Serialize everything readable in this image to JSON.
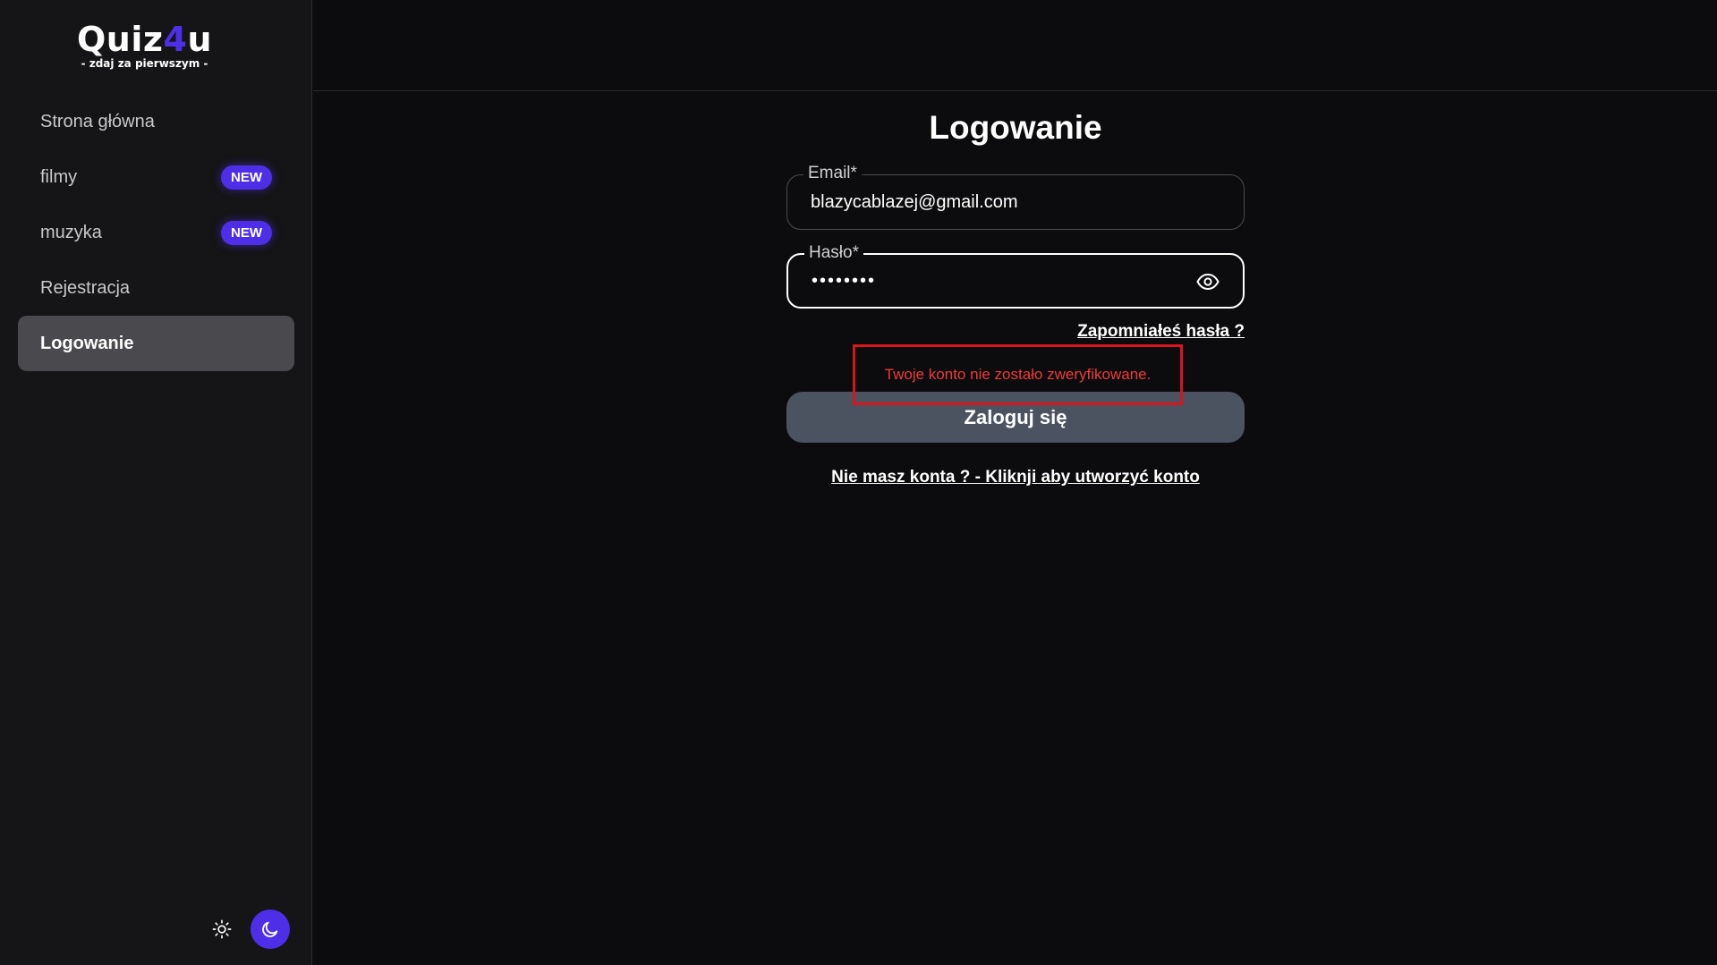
{
  "logo": {
    "title_prefix": "Quiz",
    "title_accent": "4",
    "title_suffix": "u",
    "subtitle": "- zdaj za pierwszym -"
  },
  "sidebar": {
    "items": [
      {
        "label": "Strona główna",
        "badge": ""
      },
      {
        "label": "filmy",
        "badge": "NEW"
      },
      {
        "label": "muzyka",
        "badge": "NEW"
      },
      {
        "label": "Rejestracja",
        "badge": ""
      },
      {
        "label": "Logowanie",
        "badge": "",
        "active": true
      }
    ]
  },
  "theme": {
    "light_icon": "sun-icon",
    "dark_icon": "moon-icon",
    "selected": "dark"
  },
  "form": {
    "title": "Logowanie",
    "email": {
      "label": "Email*",
      "value": "blazycablazej@gmail.com"
    },
    "password": {
      "label": "Hasło*",
      "value": "••••••••",
      "toggle_icon": "eye-icon"
    },
    "forgot_link": "Zapomniałeś hasła ?",
    "error_message": "Twoje konto nie zostało zweryfikowane.",
    "submit_label": "Zaloguj się",
    "register_link": "Nie masz konta ? - Kliknji aby utworzyć konto"
  },
  "colors": {
    "accent": "#4f2ee8",
    "error": "#d8141c",
    "background": "#0c0c0e",
    "sidebar": "#151517",
    "button": "#4b5260"
  }
}
